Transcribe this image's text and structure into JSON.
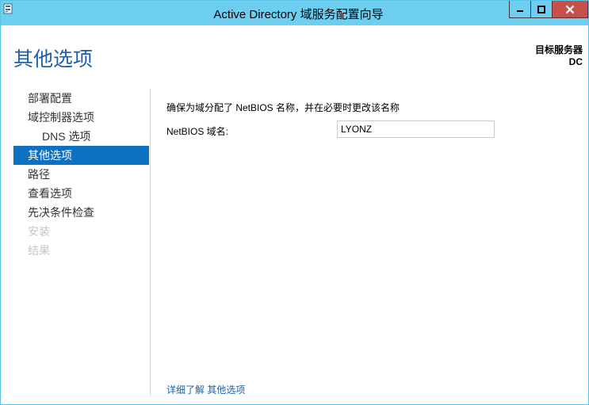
{
  "window": {
    "title": "Active Directory 域服务配置向导"
  },
  "header": {
    "page_title": "其他选项",
    "target_server_label": "目标服务器",
    "target_server_name": "DC"
  },
  "sidebar": {
    "items": [
      {
        "label": "部署配置",
        "state": "normal"
      },
      {
        "label": "域控制器选项",
        "state": "normal"
      },
      {
        "label": "DNS 选项",
        "state": "sub"
      },
      {
        "label": "其他选项",
        "state": "active"
      },
      {
        "label": "路径",
        "state": "normal"
      },
      {
        "label": "查看选项",
        "state": "normal"
      },
      {
        "label": "先决条件检查",
        "state": "normal"
      },
      {
        "label": "安装",
        "state": "disabled"
      },
      {
        "label": "结果",
        "state": "disabled"
      }
    ]
  },
  "main": {
    "description": "确保为域分配了 NetBIOS 名称，并在必要时更改该名称",
    "netbios_label": "NetBIOS 域名:",
    "netbios_value": "LYONZ",
    "more_link": "详细了解 其他选项"
  },
  "colors": {
    "titlebar": "#6dcef0",
    "accent": "#1e5fa8",
    "active_nav": "#0e70c0",
    "close_button": "#c7504a"
  },
  "icons": {
    "app": "server-manager-icon",
    "minimize": "minimize-icon",
    "maximize": "maximize-icon",
    "close": "close-icon"
  }
}
